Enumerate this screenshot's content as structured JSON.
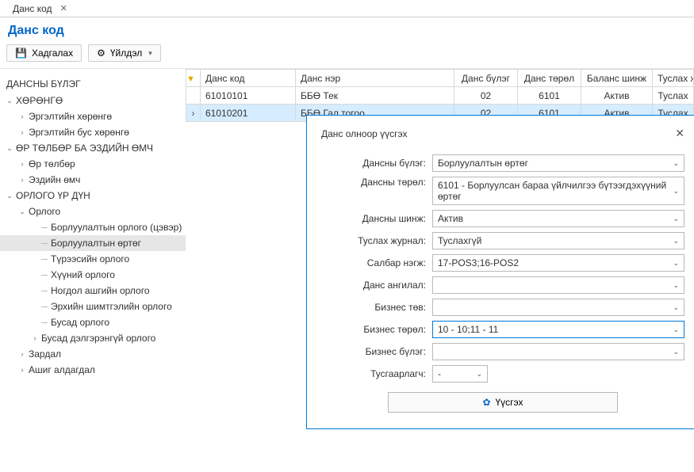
{
  "tab": {
    "title": "Данс код"
  },
  "page": {
    "title": "Данс код"
  },
  "toolbar": {
    "save": "Хадгалах",
    "action": "Үйлдэл"
  },
  "sidebar": {
    "title": "ДАНСНЫ БҮЛЭГ",
    "n_assets": "ХӨРӨНГӨ",
    "n_current": "Эргэлтийн хөрөнгө",
    "n_noncurrent": "Эргэлтийн бус хөрөнгө",
    "n_liabeq": "ӨР ТӨЛБӨР БА ЭЗДИЙН ӨМЧ",
    "n_liab": "Өр төлбөр",
    "n_equity": "Эздийн өмч",
    "n_pl": "ОРЛОГО ҮР ДҮН",
    "n_income": "Орлого",
    "n_salesnet": "Борлуулалтын орлого (цэвэр)",
    "n_cogs": "Борлуулалтын өртөг",
    "n_rent": "Түрээсийн орлого",
    "n_interest": "Хүүний орлого",
    "n_div": "Ногдол ашгийн орлого",
    "n_royalty": "Эрхийн шимтгэлийн орлого",
    "n_other": "Бусад орлого",
    "n_otherdet": "Бусад дэлгэрэнгүй орлого",
    "n_expense": "Зардал",
    "n_gainloss": "Ашиг алдагдал"
  },
  "grid": {
    "h_code": "Данс код",
    "h_name": "Данс нэр",
    "h_group": "Данс бүлэг",
    "h_type": "Данс төрөл",
    "h_bal": "Баланс шинж",
    "h_aux": "Туслах жу",
    "rows": [
      {
        "code": "61010101",
        "name": "ББӨ Тек",
        "group": "02",
        "type": "6101",
        "bal": "Актив",
        "aux": "Туслах"
      },
      {
        "code": "61010201",
        "name": "ББӨ Гал тогоо",
        "group": "02",
        "type": "6101",
        "bal": "Актив",
        "aux": "Туслах"
      }
    ]
  },
  "dialog": {
    "title": "Данс олноор үүсгэх",
    "l_group": "Дансны бүлэг:",
    "l_type": "Дансны төрөл:",
    "l_bal": "Дансны шинж:",
    "l_aux": "Туслах журнал:",
    "l_branch": "Салбар нэгж:",
    "l_cat": "Данс ангилал:",
    "l_bcenter": "Бизнес төв:",
    "l_btype": "Бизнес төрөл:",
    "l_bgroup": "Бизнес бүлэг:",
    "l_sep": "Тусгаарлагч:",
    "v_group": "Борлуулалтын өртөг",
    "v_type": "6101 - Борлуулсан бараа үйлчилгээ бүтээгдэхүүний өртөг",
    "v_bal": "Актив",
    "v_aux": "Туслахгүй",
    "v_branch": "17-POS3;16-POS2",
    "v_cat": "",
    "v_bcenter": "",
    "v_btype": "10 - 10;11 - 11",
    "v_bgroup": "",
    "v_sep": "-",
    "create": "Үүсгэх"
  }
}
